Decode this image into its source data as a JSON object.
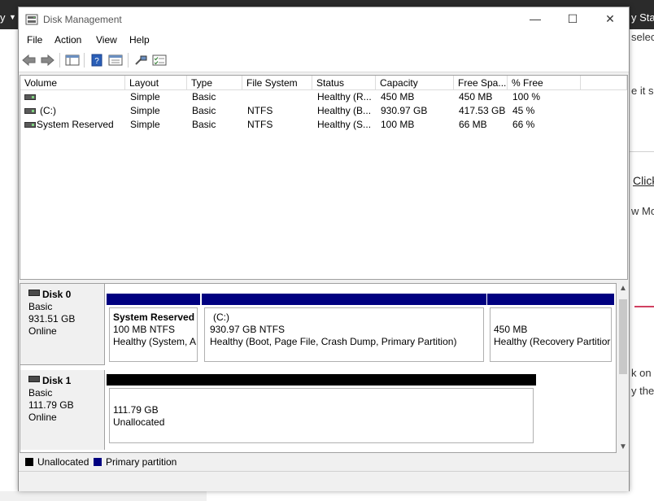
{
  "background": {
    "left_text": "y",
    "right_text": "y Sta",
    "snippets": [
      "select",
      "e it sh",
      "Click",
      "w Mor",
      "k on",
      "y the"
    ]
  },
  "window": {
    "title": "Disk Management",
    "controls": {
      "minimize": "—",
      "maximize": "☐",
      "close": "✕"
    }
  },
  "menu": [
    "File",
    "Action",
    "View",
    "Help"
  ],
  "volume_list": {
    "columns": [
      "Volume",
      "Layout",
      "Type",
      "File System",
      "Status",
      "Capacity",
      "Free Spa...",
      "% Free"
    ],
    "rows": [
      {
        "volume": "",
        "layout": "Simple",
        "type": "Basic",
        "fs": "",
        "status": "Healthy (R...",
        "capacity": "450 MB",
        "free": "450 MB",
        "pct": "100 %"
      },
      {
        "volume": "(C:)",
        "layout": "Simple",
        "type": "Basic",
        "fs": "NTFS",
        "status": "Healthy (B...",
        "capacity": "930.97 GB",
        "free": "417.53 GB",
        "pct": "45 %"
      },
      {
        "volume": "System Reserved",
        "layout": "Simple",
        "type": "Basic",
        "fs": "NTFS",
        "status": "Healthy (S...",
        "capacity": "100 MB",
        "free": "66 MB",
        "pct": "66 %"
      }
    ]
  },
  "disks": [
    {
      "name": "Disk 0",
      "type": "Basic",
      "size": "931.51 GB",
      "state": "Online",
      "partitions": [
        {
          "name": "System Reserved",
          "line1": "100 MB NTFS",
          "line2": "Healthy (System, A"
        },
        {
          "name": "(C:)",
          "line1": "930.97 GB NTFS",
          "line2": "Healthy (Boot, Page File, Crash Dump, Primary Partition)"
        },
        {
          "name": "",
          "line1": "450 MB",
          "line2": "Healthy (Recovery Partitior"
        }
      ]
    },
    {
      "name": "Disk 1",
      "type": "Basic",
      "size": "111.79 GB",
      "state": "Online",
      "partitions": [
        {
          "name": "",
          "line1": "111.79 GB",
          "line2": "Unallocated"
        }
      ]
    }
  ],
  "legend": [
    {
      "label": "Unallocated",
      "color": "#000000"
    },
    {
      "label": "Primary partition",
      "color": "#000080"
    }
  ],
  "colors": {
    "primary": "#000080",
    "unallocated": "#000000"
  }
}
